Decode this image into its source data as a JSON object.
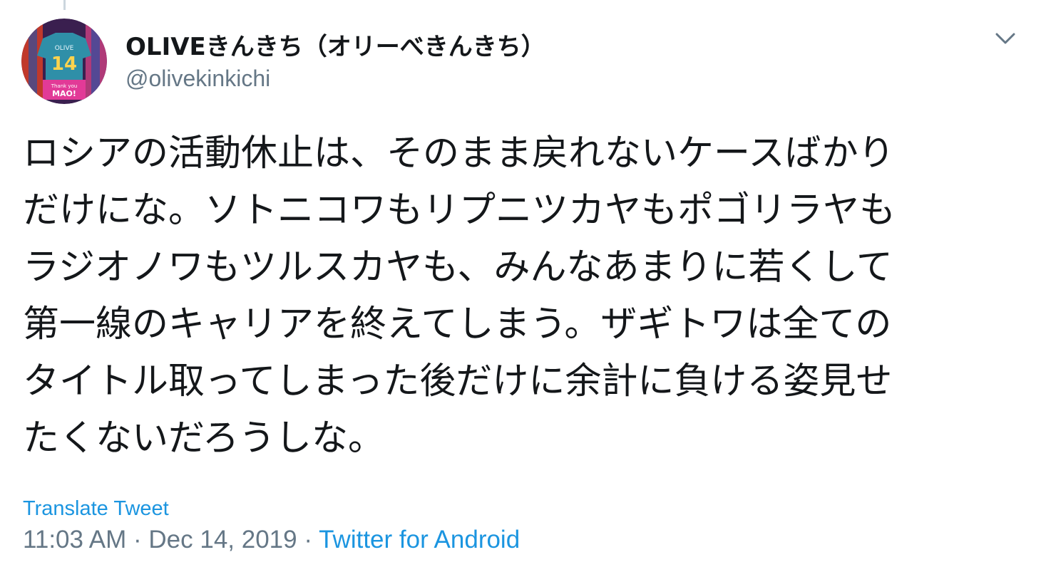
{
  "tweet": {
    "author": {
      "display_name": "OLIVEきんきち（オリーべきんきち）",
      "handle": "@olivekinkichi",
      "avatar_text": {
        "name": "OLIVE",
        "number": "14",
        "caption": "Thank you",
        "badge": "MAO!"
      }
    },
    "menu_icon": "chevron-down-icon",
    "text_lines": [
      "ロシアの活動休止は、そのまま戻れないケースばかり",
      "だけにな。ソトニコワもリプニツカヤもポゴリラヤも",
      "ラジオノワもツルスカヤも、みんなあまりに若くして",
      "第一線のキャリアを終えてしまう。ザギトワは全ての",
      "タイトル取ってしまった後だけに余計に負ける姿見せ",
      "たくないだろうしな。"
    ],
    "translate_label": "Translate Tweet",
    "time": "11:03 AM",
    "separator": "·",
    "date": "Dec 14, 2019",
    "source": "Twitter for Android"
  },
  "colors": {
    "text": "#14171a",
    "secondary": "#657786",
    "link": "#1b95e0",
    "thread_line": "#ccd6dd"
  }
}
